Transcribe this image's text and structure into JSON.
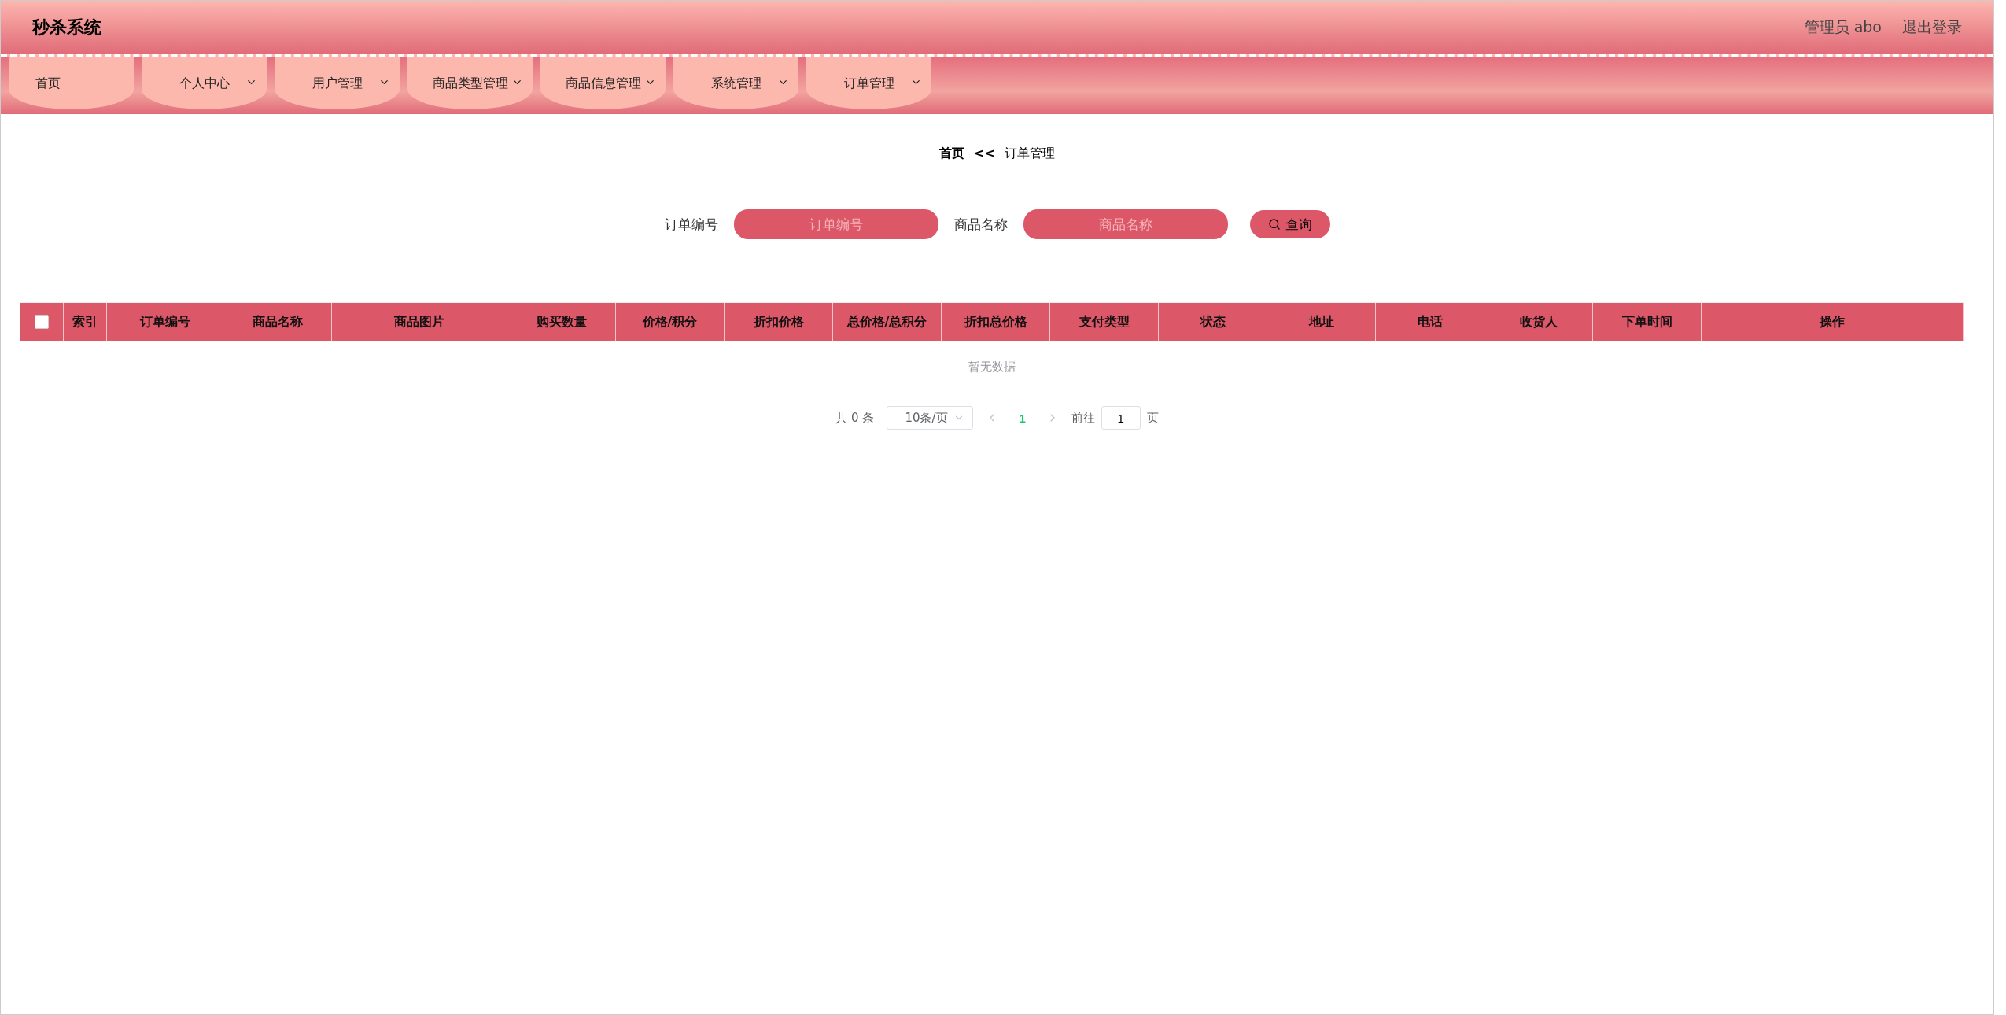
{
  "header": {
    "title": "秒杀系统",
    "user": "管理员 abo",
    "logout": "退出登录"
  },
  "nav": [
    {
      "label": "首页",
      "dropdown": false
    },
    {
      "label": "个人中心",
      "dropdown": true
    },
    {
      "label": "用户管理",
      "dropdown": true
    },
    {
      "label": "商品类型管理",
      "dropdown": true
    },
    {
      "label": "商品信息管理",
      "dropdown": true
    },
    {
      "label": "系统管理",
      "dropdown": true
    },
    {
      "label": "订单管理",
      "dropdown": true
    }
  ],
  "breadcrumb": {
    "home": "首页",
    "separator": "<<",
    "current": "订单管理"
  },
  "search": {
    "fields": [
      {
        "label": "订单编号",
        "placeholder": "订单编号"
      },
      {
        "label": "商品名称",
        "placeholder": "商品名称"
      }
    ],
    "button": "查询"
  },
  "table": {
    "select_all": {
      "checked": false
    },
    "columns": [
      "索引",
      "订单编号",
      "商品名称",
      "商品图片",
      "购买数量",
      "价格/积分",
      "折扣价格",
      "总价格/总积分",
      "折扣总价格",
      "支付类型",
      "状态",
      "地址",
      "电话",
      "收货人",
      "下单时间",
      "操作"
    ],
    "empty": "暂无数据"
  },
  "pagination": {
    "total": "共 0 条",
    "page_size": "10条/页",
    "pages": [
      {
        "label": "1",
        "selected": true
      }
    ],
    "goto": "前往",
    "goto_value": "1",
    "page_unit": "页"
  }
}
